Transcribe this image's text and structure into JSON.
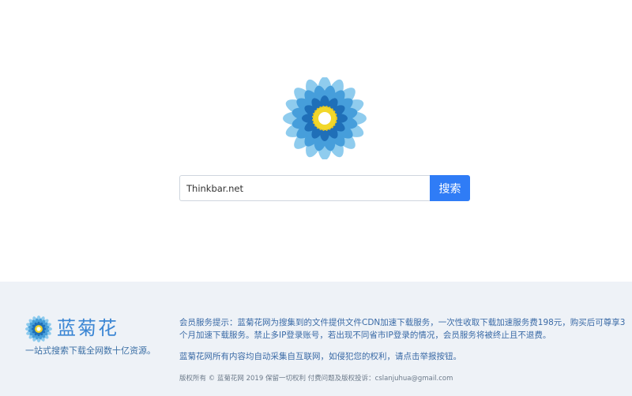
{
  "search": {
    "value": "Thinkbar.net",
    "button_label": "搜索"
  },
  "footer": {
    "brand_name": "蓝菊花",
    "slogan": "一站式搜索下载全网数十亿资源。",
    "notice": "会员服务提示：蓝菊花网为搜集到的文件提供文件CDN加速下载服务，一次性收取下载加速服务费198元，购买后可尊享3个月加速下载服务。禁止多IP登录账号，若出现不同省市IP登录的情况，会员服务将被终止且不退费。",
    "copyright_note": "蓝菊花网所有内容均自动采集自互联网，如侵犯您的权利，请点击举报按钮。",
    "copyright": "版权所有 © 蓝菊花网 2019 保留一切权利 付费问题及版权投诉：cslanjuhua@gmail.com"
  },
  "colors": {
    "accent": "#2f7cf6",
    "brand_blue": "#3b86d4",
    "footer_bg": "#eef2f7",
    "flower_center": "#f2d72a"
  },
  "icons": {
    "logo": "blue-chrysanthemum-logo-icon"
  }
}
